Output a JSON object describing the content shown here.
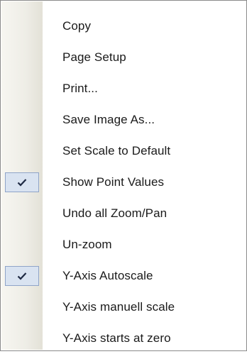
{
  "menu": {
    "items": [
      {
        "label": "Copy",
        "checked": false
      },
      {
        "label": "Page Setup",
        "checked": false
      },
      {
        "label": "Print...",
        "checked": false
      },
      {
        "label": "Save Image As...",
        "checked": false
      },
      {
        "label": "Set Scale to Default",
        "checked": false
      },
      {
        "label": "Show Point Values",
        "checked": true
      },
      {
        "label": "Undo all Zoom/Pan",
        "checked": false
      },
      {
        "label": "Un-zoom",
        "checked": false
      },
      {
        "label": "Y-Axis Autoscale",
        "checked": true
      },
      {
        "label": "Y-Axis manuell scale",
        "checked": false
      },
      {
        "label": "Y-Axis starts at zero",
        "checked": false
      }
    ]
  },
  "colors": {
    "check_highlight": "#d9e3f1",
    "check_border": "#8fa4c8",
    "check_mark": "#1f2a44"
  }
}
